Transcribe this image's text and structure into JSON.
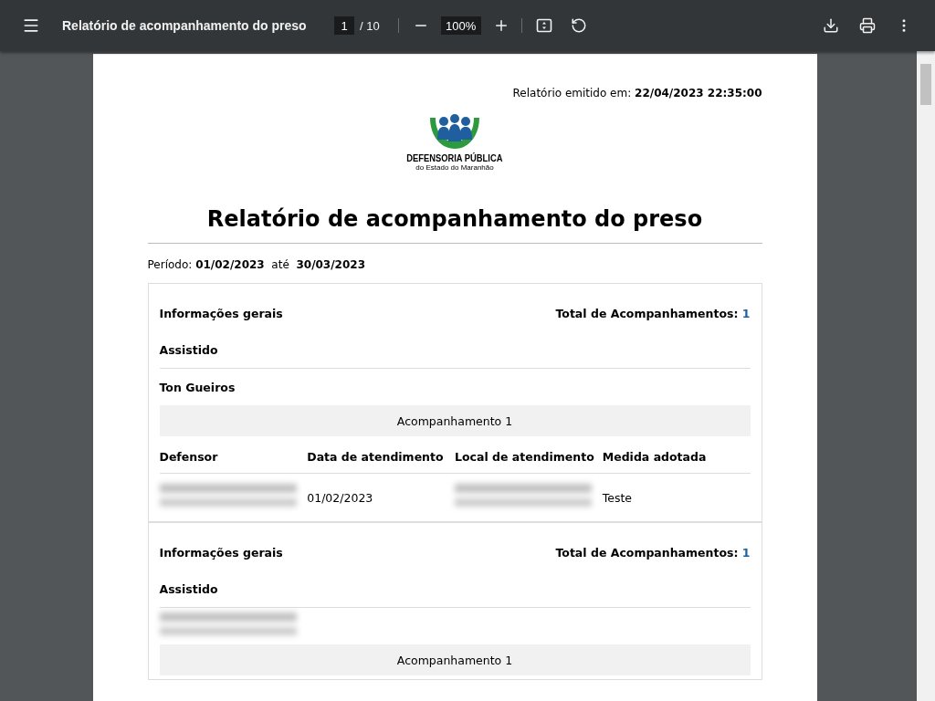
{
  "toolbar": {
    "title": "Relatório de acompanhamento do preso",
    "page": "1",
    "page_total": "/ 10",
    "zoom": "100%"
  },
  "report": {
    "issued_label": "Relatório emitido em:",
    "issued_value": "22/04/2023 22:35:00",
    "logo": {
      "name": "DEFENSORIA PÚBLICA",
      "subtitle": "do Estado do Maranhão"
    },
    "title": "Relatório de acompanhamento do preso",
    "period_label": "Período:",
    "period_start": "01/02/2023",
    "period_sep": "até",
    "period_end": "30/03/2023",
    "records": [
      {
        "section": "Informações gerais",
        "total_label": "Total de Acompanhamentos:",
        "total_value": "1",
        "assisted_label": "Assistido",
        "assisted_name": {
          "kind": "text",
          "text": "Ton Gueiros"
        },
        "followups": [
          {
            "heading": "Acompanhamento 1",
            "columns": [
              "Defensor",
              "Data de atendimento",
              "Local de atendimento",
              "Medida adotada"
            ],
            "rows": [
              [
                {
                  "kind": "blurred"
                },
                {
                  "kind": "text",
                  "text": "01/02/2023"
                },
                {
                  "kind": "blurred"
                },
                {
                  "kind": "text",
                  "text": "Teste"
                }
              ]
            ]
          }
        ]
      },
      {
        "section": "Informações gerais",
        "total_label": "Total de Acompanhamentos:",
        "total_value": "1",
        "assisted_label": "Assistido",
        "assisted_name": {
          "kind": "blurred"
        },
        "followups": [
          {
            "heading": "Acompanhamento 1"
          }
        ]
      }
    ]
  }
}
